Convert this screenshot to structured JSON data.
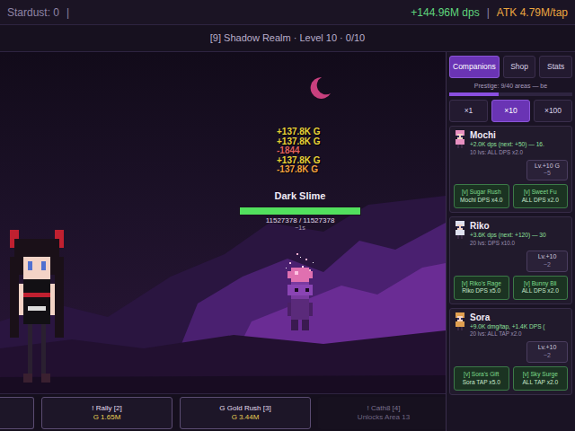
{
  "top_bar": {
    "stardust": "Stardust: 0",
    "separator": "|",
    "dps": "+144.96M dps",
    "separator2": "|",
    "atk": "ATK 4.79M/tap"
  },
  "area": {
    "title": "[9] Shadow Realm · Level 10 · 0/10"
  },
  "floaters": [
    {
      "text": "+137.8K G",
      "color": "#e8d23a"
    },
    {
      "text": "+137.8K G",
      "color": "#e8d23a"
    },
    {
      "text": "-1844",
      "color": "#e06060"
    },
    {
      "text": "+137.8K G",
      "color": "#e8d23a"
    },
    {
      "text": "-137.8K G",
      "color": "#f0a040"
    }
  ],
  "enemy": {
    "name": "Dark Slime",
    "hp": "11527378 / 11527378",
    "level": 1.0,
    "timer": "~1s"
  },
  "skills": [
    {
      "label": "! Rally [2]",
      "cost": "G 1.65M",
      "disabled": false
    },
    {
      "label": "G Gold Rush [3]",
      "cost": "G 3.44M",
      "disabled": false
    },
    {
      "label": "! Cath8 [4]",
      "cost": "Unlocks Area 13",
      "disabled": true
    }
  ],
  "sidebar": {
    "tabs": [
      {
        "label": "Companions",
        "selected": true
      },
      {
        "label": "Shop",
        "selected": false
      },
      {
        "label": "Stats",
        "selected": false
      }
    ],
    "prestige": {
      "text": "Prestige: 9/40 areas — be",
      "level": 0.4
    },
    "multipliers": [
      {
        "label": "×1",
        "selected": false
      },
      {
        "label": "×10",
        "selected": true
      },
      {
        "label": "×100",
        "selected": false
      }
    ],
    "companions": [
      {
        "name": "Mochi",
        "color": "#e890c0",
        "stats": "+2.0K dps (next: +50) — 16.",
        "milestone": "10 lvs: ALL DPS x2.0",
        "levelup": "Lv.+10 G",
        "levelup_cost": "~5",
        "upgrades": [
          {
            "name": "[v] Sugar Rush",
            "effect": "Mochi DPS x4.0"
          },
          {
            "name": "[v] Sweet Fu",
            "effect": "ALL DPS x2.0"
          }
        ]
      },
      {
        "name": "Riko",
        "color": "#dfe2f0",
        "stats": "+3.6K dps (next: +120) — 30",
        "milestone": "20 lvs: DPS x10.0",
        "levelup": "Lv.+10",
        "levelup_cost": "~2",
        "upgrades": [
          {
            "name": "[v] Riko's Rage",
            "effect": "Riko DPS x5.0"
          },
          {
            "name": "[v] Bunny Bli",
            "effect": "ALL DPS x2.0"
          }
        ]
      },
      {
        "name": "Sora",
        "color": "#e0a050",
        "stats": "+9.0K dmg/tap, +1.4K DPS (",
        "milestone": "20 lvs: ALL TAP x2.0",
        "levelup": "Lv.+10",
        "levelup_cost": "~2",
        "upgrades": [
          {
            "name": "[v] Sora's Gift",
            "effect": "Sora TAP x5.0"
          },
          {
            "name": "[v] Sky Surge",
            "effect": "ALL TAP x2.0"
          }
        ]
      }
    ]
  }
}
